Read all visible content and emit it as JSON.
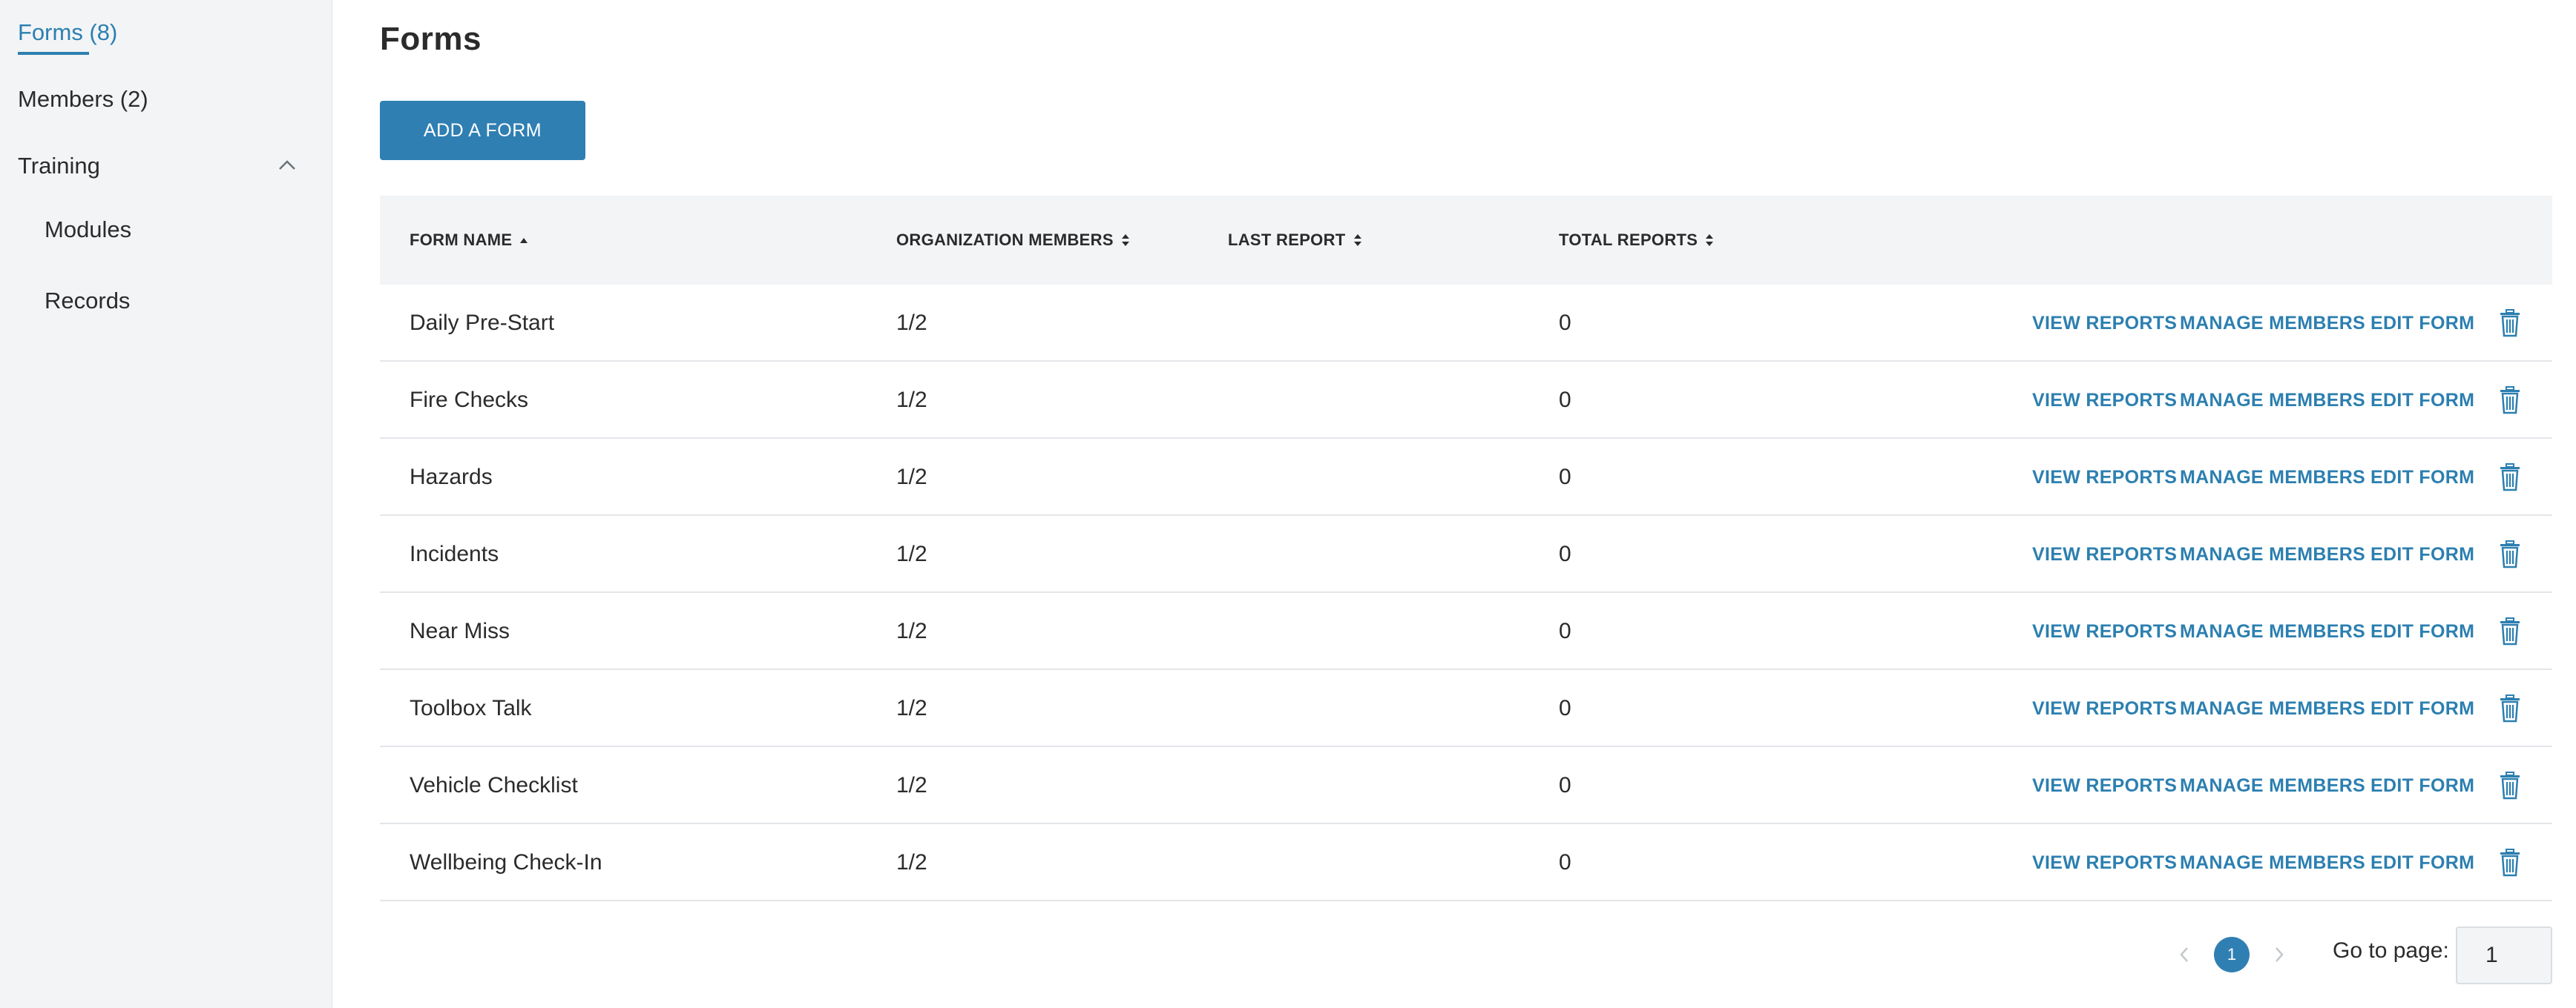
{
  "sidebar": {
    "items": [
      {
        "label": "Forms (8)",
        "active": true
      },
      {
        "label": "Members (2)"
      },
      {
        "label": "Training",
        "expanded": true,
        "icon": "chevron-up-icon"
      }
    ],
    "sub_items": [
      {
        "label": "Modules"
      },
      {
        "label": "Records"
      }
    ]
  },
  "page": {
    "title": "Forms",
    "add_button": "ADD A FORM"
  },
  "table": {
    "columns": [
      {
        "label": "FORM NAME",
        "sort": "ascending"
      },
      {
        "label": "ORGANIZATION MEMBERS",
        "sort": "sortable"
      },
      {
        "label": "LAST REPORT",
        "sort": "sortable"
      },
      {
        "label": "TOTAL REPORTS",
        "sort": "sortable"
      }
    ],
    "actions": {
      "view": "VIEW REPORTS",
      "manage": "MANAGE MEMBERS",
      "edit": "EDIT FORM",
      "delete_icon": "trash-icon"
    },
    "rows": [
      {
        "name": "Daily Pre-Start",
        "members": "1/2",
        "last_report": "",
        "total": "0"
      },
      {
        "name": "Fire Checks",
        "members": "1/2",
        "last_report": "",
        "total": "0"
      },
      {
        "name": "Hazards",
        "members": "1/2",
        "last_report": "",
        "total": "0"
      },
      {
        "name": "Incidents",
        "members": "1/2",
        "last_report": "",
        "total": "0"
      },
      {
        "name": "Near Miss",
        "members": "1/2",
        "last_report": "",
        "total": "0"
      },
      {
        "name": "Toolbox Talk",
        "members": "1/2",
        "last_report": "",
        "total": "0"
      },
      {
        "name": "Vehicle Checklist",
        "members": "1/2",
        "last_report": "",
        "total": "0"
      },
      {
        "name": "Wellbeing Check-In",
        "members": "1/2",
        "last_report": "",
        "total": "0"
      }
    ]
  },
  "pagination": {
    "current_page": "1",
    "goto_label": "Go to page:",
    "goto_value": "1"
  },
  "colors": {
    "accent": "#2f7fb3",
    "link": "#2c7fb0",
    "sidebar_bg": "#f2f4f6",
    "header_bg": "#f2f4f6"
  }
}
